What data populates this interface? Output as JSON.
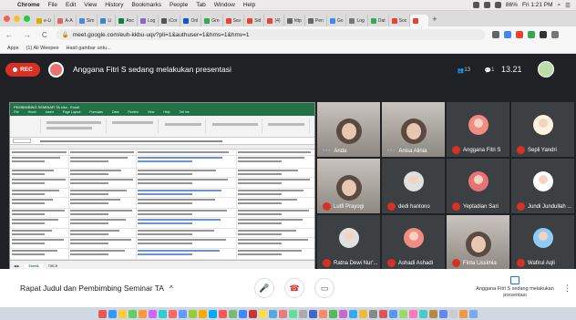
{
  "macmenu": {
    "app": "Chrome",
    "items": [
      "File",
      "Edit",
      "View",
      "History",
      "Bookmarks",
      "People",
      "Tab",
      "Window",
      "Help"
    ],
    "battery": "86%",
    "clock": "Fri 1:21 PM"
  },
  "tabs": [
    {
      "label": "e-Li",
      "color": "#e0a800"
    },
    {
      "label": "A-A",
      "color": "#e06666"
    },
    {
      "label": "Sim",
      "color": "#4a86e8"
    },
    {
      "label": "Li",
      "color": "#3d85c6"
    },
    {
      "label": "Anc",
      "color": "#0b8043"
    },
    {
      "label": "Log",
      "color": "#8e63ce"
    },
    {
      "label": "iCor",
      "color": "#555"
    },
    {
      "label": "Onl",
      "color": "#1155cc"
    },
    {
      "label": "Gro",
      "color": "#34a853"
    },
    {
      "label": "Sav",
      "color": "#ea4335"
    },
    {
      "label": "Sid",
      "color": "#ea4335"
    },
    {
      "label": "(4)",
      "color": "#ea4335"
    },
    {
      "label": "http",
      "color": "#666"
    },
    {
      "label": "Pen",
      "color": "#666"
    },
    {
      "label": "Go",
      "color": "#4285f4"
    },
    {
      "label": "Log",
      "color": "#777"
    },
    {
      "label": "Dat",
      "color": "#34a853"
    },
    {
      "label": "Soc",
      "color": "#ea4335"
    },
    {
      "label": "",
      "color": "#ea4335"
    }
  ],
  "address": {
    "back": "←",
    "forward": "→",
    "reload": "C",
    "url": "meet.google.com/euh-kkbu-uqv?pli=1&authuser=1&hms=1&hmv=1"
  },
  "bookmarks": [
    "Apps",
    "(1) Ali Weepee",
    "Hasil gambar untu..."
  ],
  "meet": {
    "rec": "REC",
    "presenting": "Anggana Fitri S sedang melakukan presentasi",
    "participants_count": "13",
    "chat_count": "1",
    "time": "13.21",
    "meeting_title": "Rapat Judul dan Pembimbing Seminar TA",
    "present_note": "Anggana Fitri S sedang melakukan presentasi",
    "chevron": "^",
    "mic_icon": "🎤",
    "hangup_icon": "☎",
    "present_icon": "▭",
    "more": "⋮"
  },
  "excel": {
    "title": "PEMBIMBING SEMINAR TA.xlsx - Excel",
    "menu": [
      "File",
      "Home",
      "Insert",
      "Page Layout",
      "Formulas",
      "Data",
      "Review",
      "View",
      "Help",
      "Tell me"
    ],
    "sheet_tab": "Sheet1",
    "sheet_tab2": "TIBCB"
  },
  "tiles": [
    {
      "name": "Anda",
      "type": "cam"
    },
    {
      "name": "Anisa Alinia",
      "type": "cam"
    },
    {
      "name": "Anggana Fitri S",
      "type": "avatar",
      "color": "#f28b82"
    },
    {
      "name": "Sepli Yandri",
      "type": "avatar",
      "color": "#fff3e0"
    },
    {
      "name": "Lutfi Prayogi",
      "type": "cam"
    },
    {
      "name": "dedi hantono",
      "type": "avatar",
      "color": "#e0e0e0"
    },
    {
      "name": "Yeptadian Sari",
      "type": "avatar",
      "color": "#e57373"
    },
    {
      "name": "Jundi Jundullah ...",
      "type": "avatar",
      "color": "#ffffff"
    },
    {
      "name": "Ratna Dewi Nur'...",
      "type": "avatar",
      "color": "#e0e0e0"
    },
    {
      "name": "Ashadi Ashadi",
      "type": "avatar",
      "color": "#f28b82"
    },
    {
      "name": "Finta Lissimia",
      "type": "cam"
    },
    {
      "name": "Wafirul Aqli",
      "type": "avatar",
      "color": "#90caf9"
    }
  ]
}
